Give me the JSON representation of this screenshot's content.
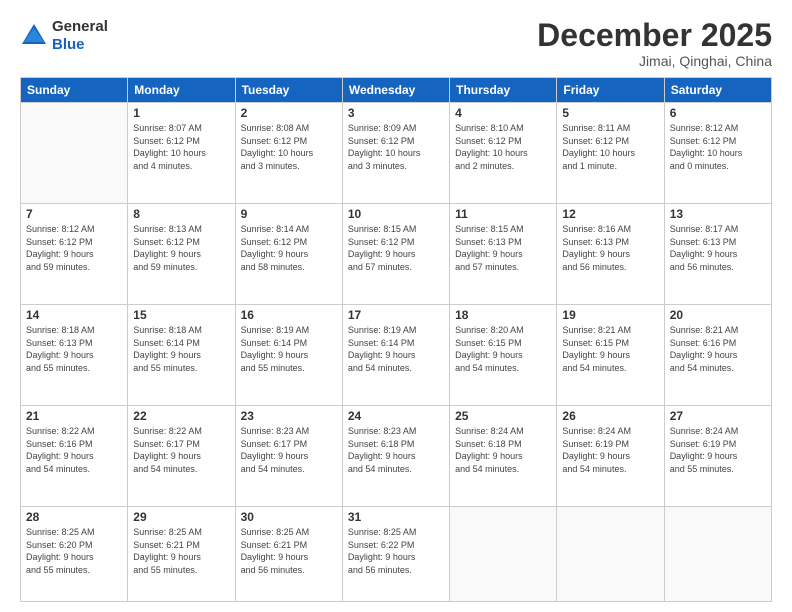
{
  "header": {
    "logo_general": "General",
    "logo_blue": "Blue",
    "month_title": "December 2025",
    "location": "Jimai, Qinghai, China"
  },
  "days_of_week": [
    "Sunday",
    "Monday",
    "Tuesday",
    "Wednesday",
    "Thursday",
    "Friday",
    "Saturday"
  ],
  "weeks": [
    [
      {
        "day": "",
        "info": ""
      },
      {
        "day": "1",
        "info": "Sunrise: 8:07 AM\nSunset: 6:12 PM\nDaylight: 10 hours\nand 4 minutes."
      },
      {
        "day": "2",
        "info": "Sunrise: 8:08 AM\nSunset: 6:12 PM\nDaylight: 10 hours\nand 3 minutes."
      },
      {
        "day": "3",
        "info": "Sunrise: 8:09 AM\nSunset: 6:12 PM\nDaylight: 10 hours\nand 3 minutes."
      },
      {
        "day": "4",
        "info": "Sunrise: 8:10 AM\nSunset: 6:12 PM\nDaylight: 10 hours\nand 2 minutes."
      },
      {
        "day": "5",
        "info": "Sunrise: 8:11 AM\nSunset: 6:12 PM\nDaylight: 10 hours\nand 1 minute."
      },
      {
        "day": "6",
        "info": "Sunrise: 8:12 AM\nSunset: 6:12 PM\nDaylight: 10 hours\nand 0 minutes."
      }
    ],
    [
      {
        "day": "7",
        "info": "Sunrise: 8:12 AM\nSunset: 6:12 PM\nDaylight: 9 hours\nand 59 minutes."
      },
      {
        "day": "8",
        "info": "Sunrise: 8:13 AM\nSunset: 6:12 PM\nDaylight: 9 hours\nand 59 minutes."
      },
      {
        "day": "9",
        "info": "Sunrise: 8:14 AM\nSunset: 6:12 PM\nDaylight: 9 hours\nand 58 minutes."
      },
      {
        "day": "10",
        "info": "Sunrise: 8:15 AM\nSunset: 6:12 PM\nDaylight: 9 hours\nand 57 minutes."
      },
      {
        "day": "11",
        "info": "Sunrise: 8:15 AM\nSunset: 6:13 PM\nDaylight: 9 hours\nand 57 minutes."
      },
      {
        "day": "12",
        "info": "Sunrise: 8:16 AM\nSunset: 6:13 PM\nDaylight: 9 hours\nand 56 minutes."
      },
      {
        "day": "13",
        "info": "Sunrise: 8:17 AM\nSunset: 6:13 PM\nDaylight: 9 hours\nand 56 minutes."
      }
    ],
    [
      {
        "day": "14",
        "info": "Sunrise: 8:18 AM\nSunset: 6:13 PM\nDaylight: 9 hours\nand 55 minutes."
      },
      {
        "day": "15",
        "info": "Sunrise: 8:18 AM\nSunset: 6:14 PM\nDaylight: 9 hours\nand 55 minutes."
      },
      {
        "day": "16",
        "info": "Sunrise: 8:19 AM\nSunset: 6:14 PM\nDaylight: 9 hours\nand 55 minutes."
      },
      {
        "day": "17",
        "info": "Sunrise: 8:19 AM\nSunset: 6:14 PM\nDaylight: 9 hours\nand 54 minutes."
      },
      {
        "day": "18",
        "info": "Sunrise: 8:20 AM\nSunset: 6:15 PM\nDaylight: 9 hours\nand 54 minutes."
      },
      {
        "day": "19",
        "info": "Sunrise: 8:21 AM\nSunset: 6:15 PM\nDaylight: 9 hours\nand 54 minutes."
      },
      {
        "day": "20",
        "info": "Sunrise: 8:21 AM\nSunset: 6:16 PM\nDaylight: 9 hours\nand 54 minutes."
      }
    ],
    [
      {
        "day": "21",
        "info": "Sunrise: 8:22 AM\nSunset: 6:16 PM\nDaylight: 9 hours\nand 54 minutes."
      },
      {
        "day": "22",
        "info": "Sunrise: 8:22 AM\nSunset: 6:17 PM\nDaylight: 9 hours\nand 54 minutes."
      },
      {
        "day": "23",
        "info": "Sunrise: 8:23 AM\nSunset: 6:17 PM\nDaylight: 9 hours\nand 54 minutes."
      },
      {
        "day": "24",
        "info": "Sunrise: 8:23 AM\nSunset: 6:18 PM\nDaylight: 9 hours\nand 54 minutes."
      },
      {
        "day": "25",
        "info": "Sunrise: 8:24 AM\nSunset: 6:18 PM\nDaylight: 9 hours\nand 54 minutes."
      },
      {
        "day": "26",
        "info": "Sunrise: 8:24 AM\nSunset: 6:19 PM\nDaylight: 9 hours\nand 54 minutes."
      },
      {
        "day": "27",
        "info": "Sunrise: 8:24 AM\nSunset: 6:19 PM\nDaylight: 9 hours\nand 55 minutes."
      }
    ],
    [
      {
        "day": "28",
        "info": "Sunrise: 8:25 AM\nSunset: 6:20 PM\nDaylight: 9 hours\nand 55 minutes."
      },
      {
        "day": "29",
        "info": "Sunrise: 8:25 AM\nSunset: 6:21 PM\nDaylight: 9 hours\nand 55 minutes."
      },
      {
        "day": "30",
        "info": "Sunrise: 8:25 AM\nSunset: 6:21 PM\nDaylight: 9 hours\nand 56 minutes."
      },
      {
        "day": "31",
        "info": "Sunrise: 8:25 AM\nSunset: 6:22 PM\nDaylight: 9 hours\nand 56 minutes."
      },
      {
        "day": "",
        "info": ""
      },
      {
        "day": "",
        "info": ""
      },
      {
        "day": "",
        "info": ""
      }
    ]
  ]
}
